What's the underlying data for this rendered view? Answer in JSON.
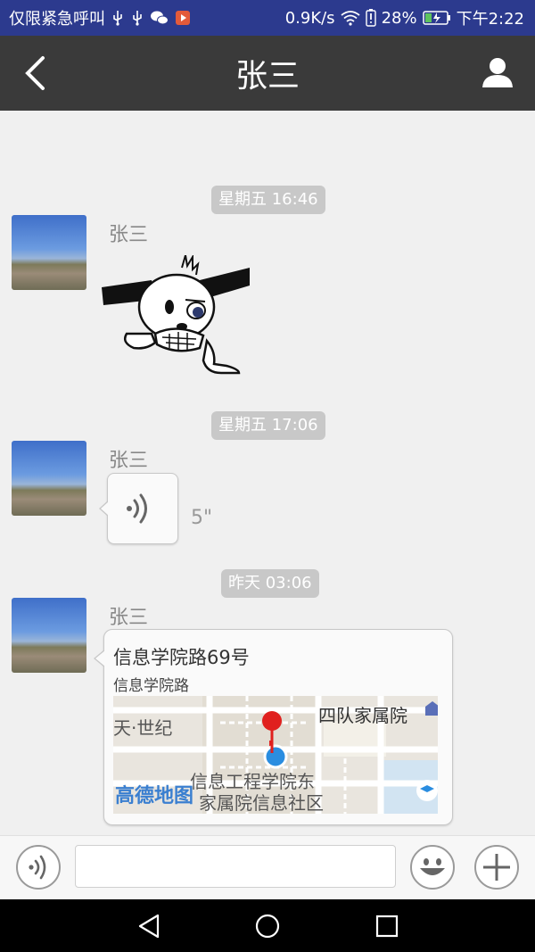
{
  "status_bar": {
    "left_text": "仅限紧急呼叫",
    "speed": "0.9K/s",
    "battery": "28%",
    "time": "下午2:22",
    "icons": [
      "usb-icon",
      "usb-icon",
      "wechat-icon",
      "video-app-icon",
      "wifi-icon",
      "battery-warning-icon",
      "battery-charging-icon"
    ]
  },
  "header": {
    "title": "张三",
    "back_icon": "chevron-left-icon",
    "profile_icon": "user-icon"
  },
  "messages": [
    {
      "timestamp": "星期五 16:46",
      "sender": "张三",
      "type": "sticker"
    },
    {
      "timestamp": "星期五 17:06",
      "sender": "张三",
      "type": "voice",
      "duration": "5\""
    },
    {
      "timestamp": "昨天 03:06",
      "sender": "张三",
      "type": "location",
      "location_title": "信息学院路69号",
      "location_subtitle": "信息学院路",
      "map_labels": [
        "天·世纪",
        "四队家属院",
        "信息工程学院东",
        "家属院信息社区",
        "高德地图"
      ]
    }
  ],
  "input_bar": {
    "text_value": "",
    "icons": [
      "voice-icon",
      "emoji-icon",
      "add-icon"
    ]
  },
  "system_nav": {
    "icons": [
      "back-triangle-icon",
      "home-circle-icon",
      "recents-square-icon"
    ]
  },
  "colors": {
    "status_bar_bg": "#2c3a8e",
    "header_bg": "#3a3a3a",
    "chat_bg": "#f0f0f0",
    "timestamp_pill": "#c8c8c8",
    "map_pin": "#e0201e",
    "map_location_dot": "#2a8de0"
  }
}
